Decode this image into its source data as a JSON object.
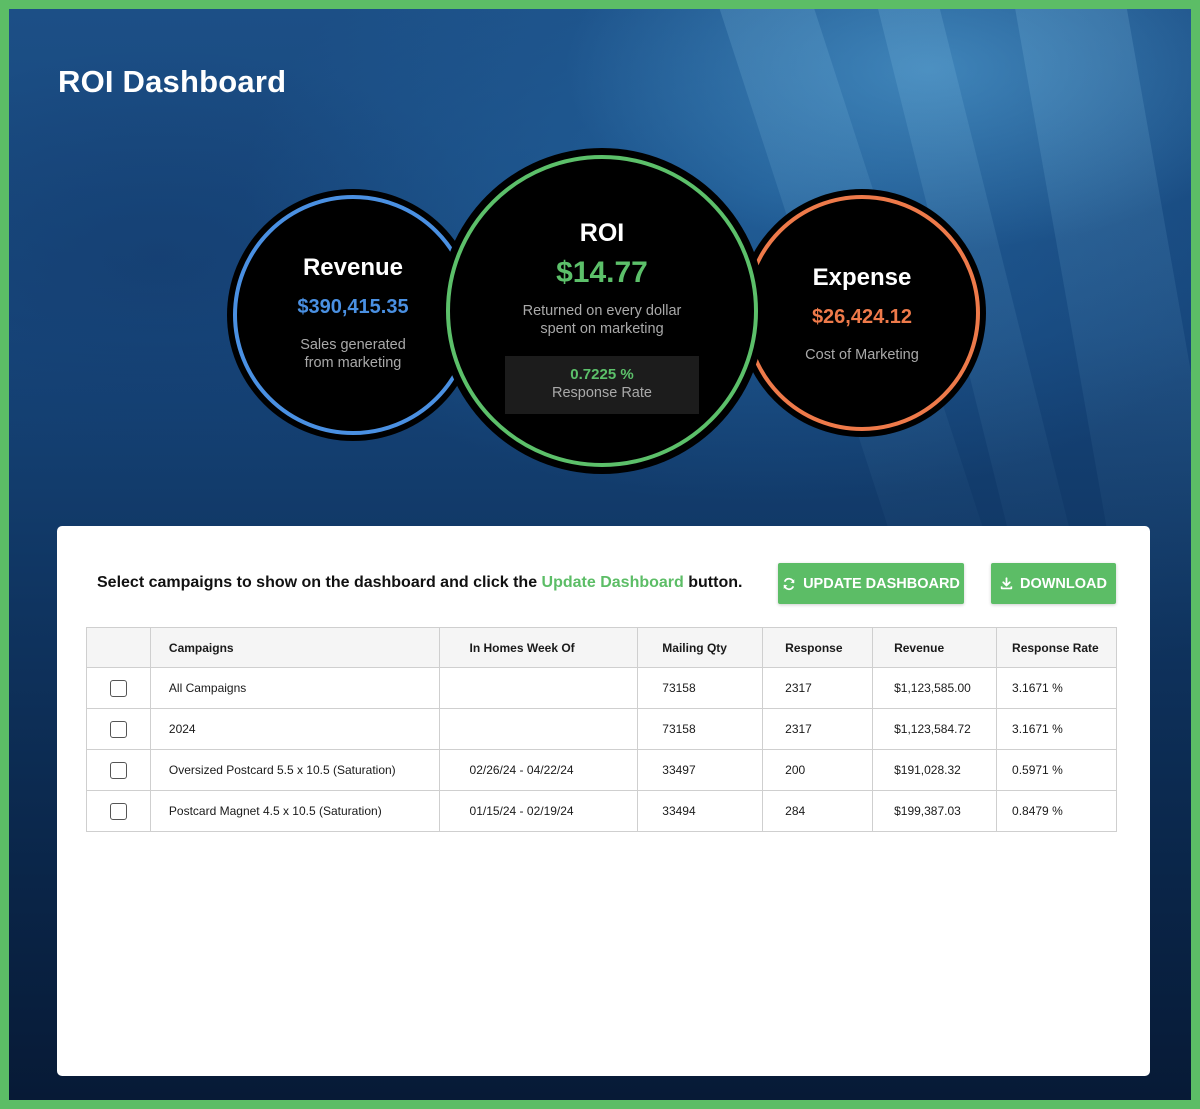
{
  "page": {
    "title": "ROI Dashboard"
  },
  "metrics": {
    "revenue": {
      "title": "Revenue",
      "value": "$390,415.35",
      "description_line1": "Sales generated",
      "description_line2": "from marketing",
      "color": "#4a90e2"
    },
    "roi": {
      "title": "ROI",
      "value": "$14.77",
      "description_line1": "Returned on every dollar",
      "description_line2": "spent on marketing",
      "response_rate_value": "0.7225 %",
      "response_rate_label": "Response Rate",
      "color": "#5cc06a"
    },
    "expense": {
      "title": "Expense",
      "value": "$26,424.12",
      "description": "Cost of Marketing",
      "color": "#ee7a4a"
    }
  },
  "panel": {
    "instruction_prefix": "Select campaigns to show on the dashboard and click the ",
    "instruction_link": "Update Dashboard",
    "instruction_suffix": " button.",
    "update_button": {
      "label": "UPDATE DASHBOARD",
      "icon": "refresh-icon"
    },
    "download_button": {
      "label": "DOWNLOAD",
      "icon": "download-icon"
    }
  },
  "table": {
    "columns": [
      "",
      "Campaigns",
      "In Homes Week Of",
      "Mailing Qty",
      "Response",
      "Revenue",
      "Response Rate"
    ],
    "rows": [
      {
        "checked": false,
        "campaign": "All Campaigns",
        "in_homes": "",
        "mailing_qty": "73158",
        "response": "2317",
        "revenue": "$1,123,585.00",
        "response_rate": "3.1671 %"
      },
      {
        "checked": false,
        "campaign": "2024",
        "in_homes": "",
        "mailing_qty": "73158",
        "response": "2317",
        "revenue": "$1,123,584.72",
        "response_rate": "3.1671 %"
      },
      {
        "checked": false,
        "campaign": "Oversized Postcard 5.5 x 10.5 (Saturation)",
        "in_homes": "02/26/24 - 04/22/24",
        "mailing_qty": "33497",
        "response": "200",
        "revenue": "$191,028.32",
        "response_rate": "0.5971 %"
      },
      {
        "checked": false,
        "campaign": "Postcard Magnet 4.5 x 10.5 (Saturation)",
        "in_homes": "01/15/24 - 02/19/24",
        "mailing_qty": "33494",
        "response": "284",
        "revenue": "$199,387.03",
        "response_rate": "0.8479 %"
      }
    ]
  },
  "colors": {
    "accent_green": "#5cbd66",
    "frame_border": "#5cbd66"
  }
}
